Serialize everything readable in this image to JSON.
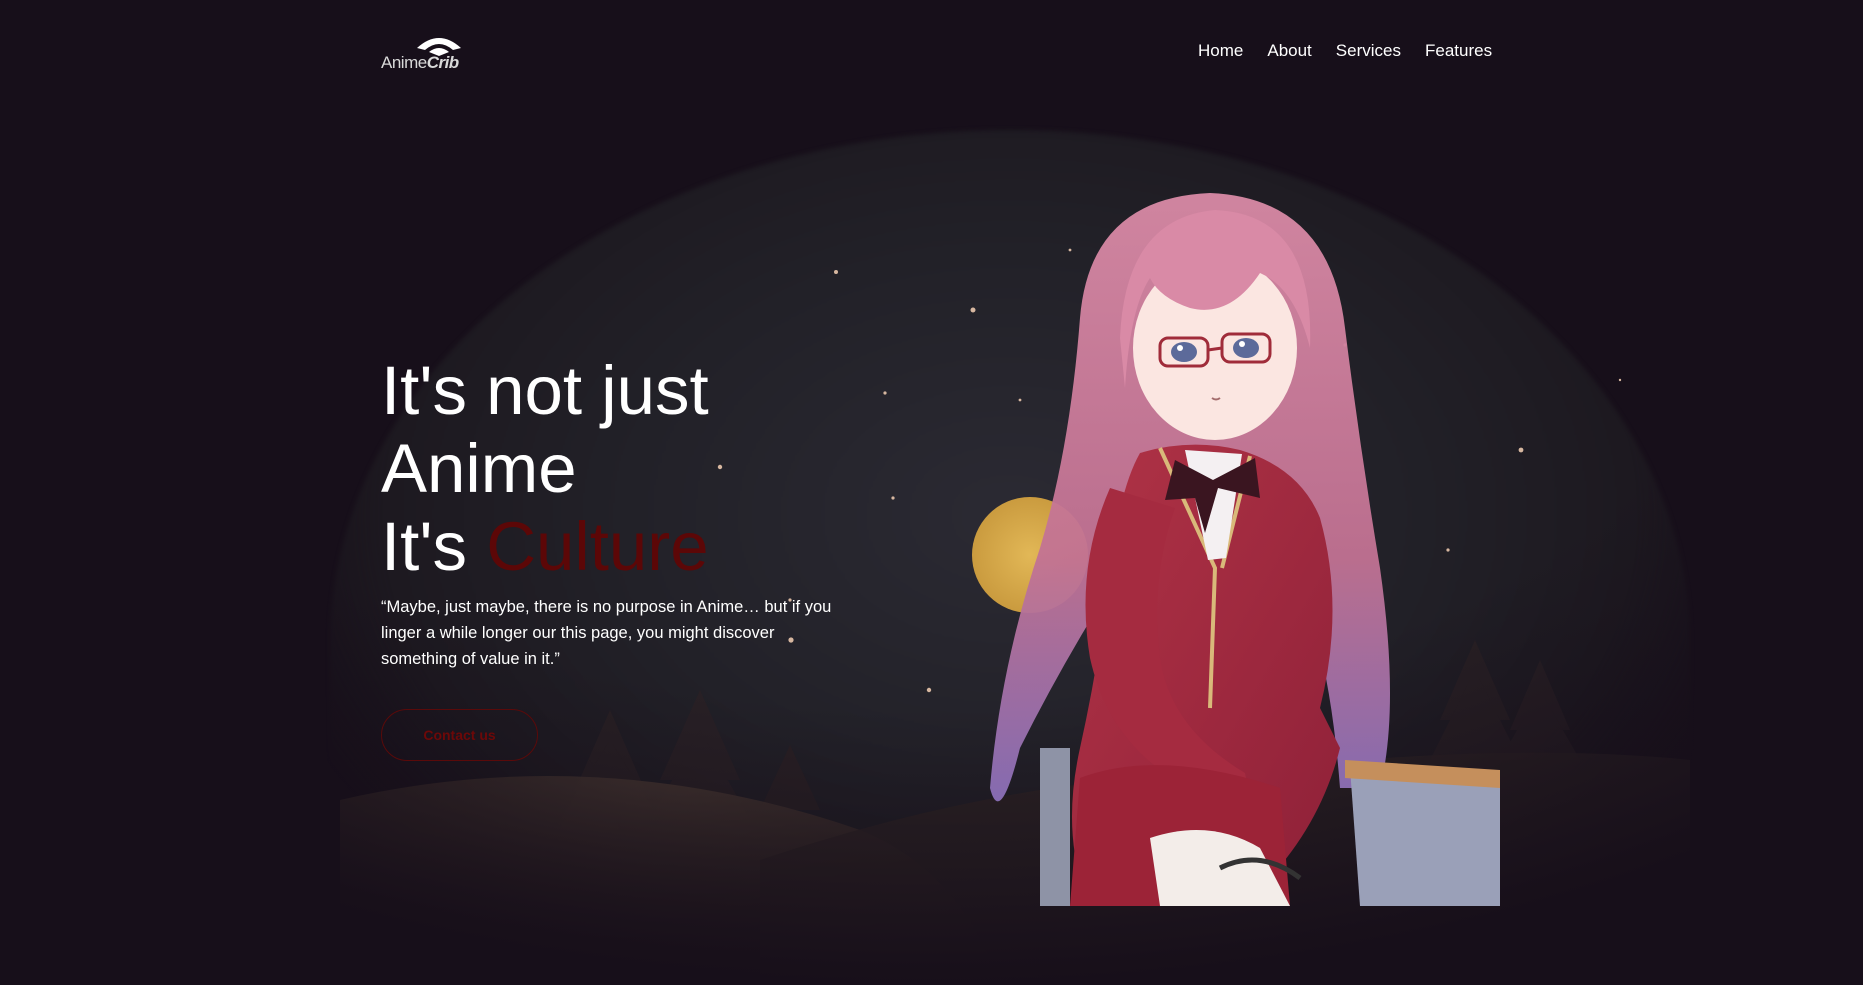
{
  "header": {
    "logo": {
      "text_main": "Anime",
      "text_bold": "Crib"
    },
    "nav": [
      {
        "label": "Home"
      },
      {
        "label": "About"
      },
      {
        "label": "Services"
      },
      {
        "label": "Features"
      }
    ]
  },
  "hero": {
    "headline_line1": "It's not just",
    "headline_line2": "Anime",
    "headline_line3_prefix": "It's ",
    "headline_line3_accent": "Culture",
    "quote": "“Maybe, just maybe, there is no purpose in Anime… but if you linger a while longer our this page, you might discover something of value in it.”",
    "cta_label": "Contact us"
  },
  "colors": {
    "background": "#170f1a",
    "accent": "#5c0707",
    "text": "#ffffff"
  }
}
